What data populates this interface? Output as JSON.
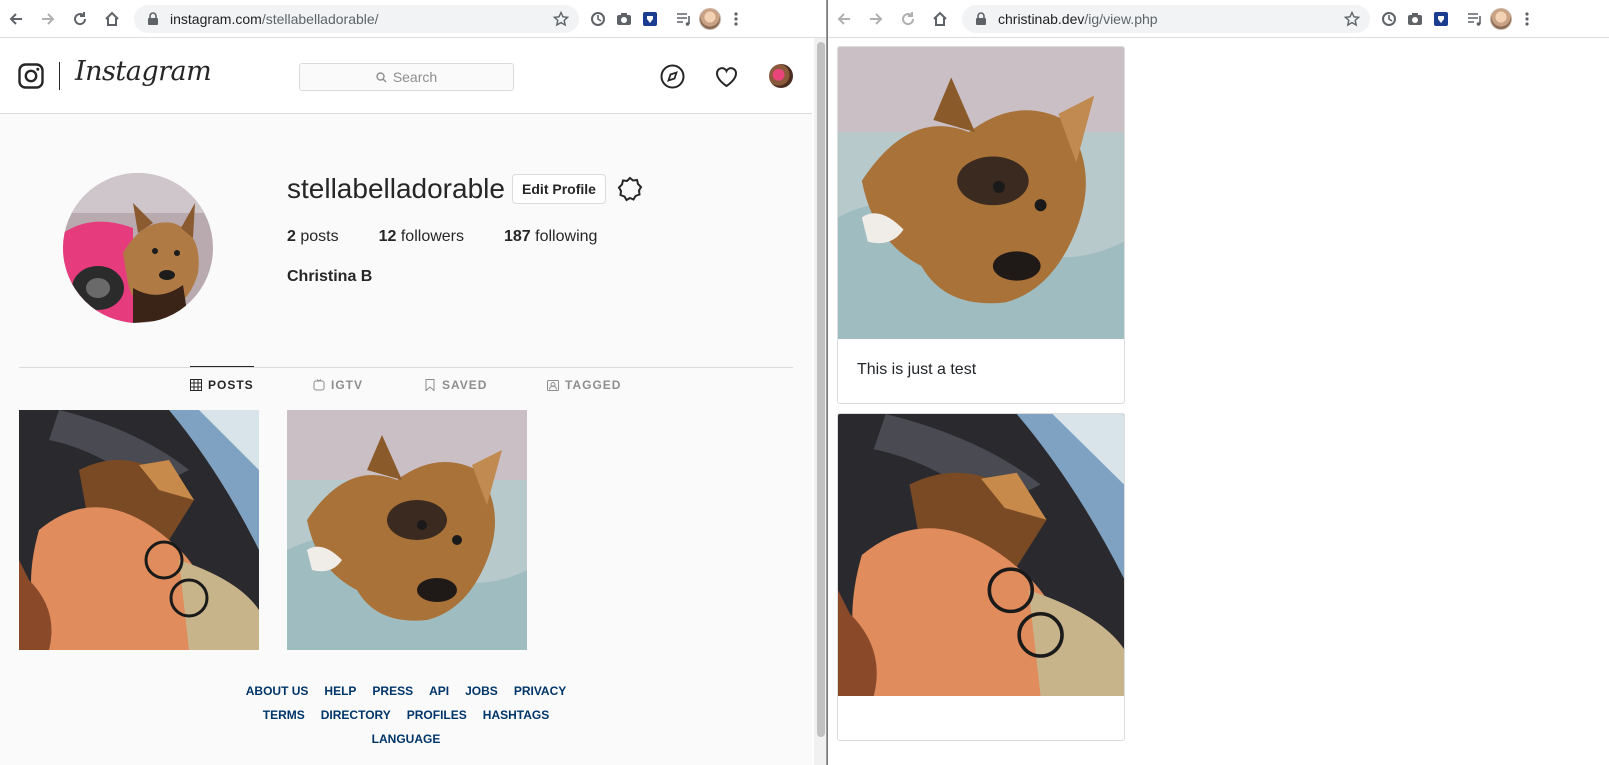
{
  "left_browser": {
    "url_host": "instagram.com",
    "url_path": "/stellabelladorable/"
  },
  "right_browser": {
    "url_host": "christinab.dev",
    "url_path": "/ig/view.php"
  },
  "instagram": {
    "wordmark": "Instagram",
    "search_placeholder": "Search",
    "profile": {
      "username": "stellabelladorable",
      "edit_profile_label": "Edit Profile",
      "posts_count": "2",
      "posts_label": "posts",
      "followers_count": "12",
      "followers_label": "followers",
      "following_count": "187",
      "following_label": "following",
      "full_name": "Christina B"
    },
    "tabs": [
      {
        "label": "POSTS",
        "icon": "grid-icon",
        "active": true
      },
      {
        "label": "IGTV",
        "icon": "tv-icon",
        "active": false
      },
      {
        "label": "SAVED",
        "icon": "bookmark-icon",
        "active": false
      },
      {
        "label": "TAGGED",
        "icon": "tagged-icon",
        "active": false
      }
    ],
    "footer_row1": [
      "ABOUT US",
      "HELP",
      "PRESS",
      "API",
      "JOBS",
      "PRIVACY"
    ],
    "footer_row2": [
      "TERMS",
      "DIRECTORY",
      "PROFILES",
      "HASHTAGS"
    ],
    "footer_row3": [
      "LANGUAGE"
    ]
  },
  "view_page": {
    "cards": [
      {
        "caption": "This is just a test",
        "photo": "dog-on-blanket"
      },
      {
        "caption": "",
        "photo": "person-with-dog"
      }
    ]
  },
  "colors": {
    "link_blue": "#003569",
    "border": "#dbdbdb",
    "text": "#262626"
  }
}
